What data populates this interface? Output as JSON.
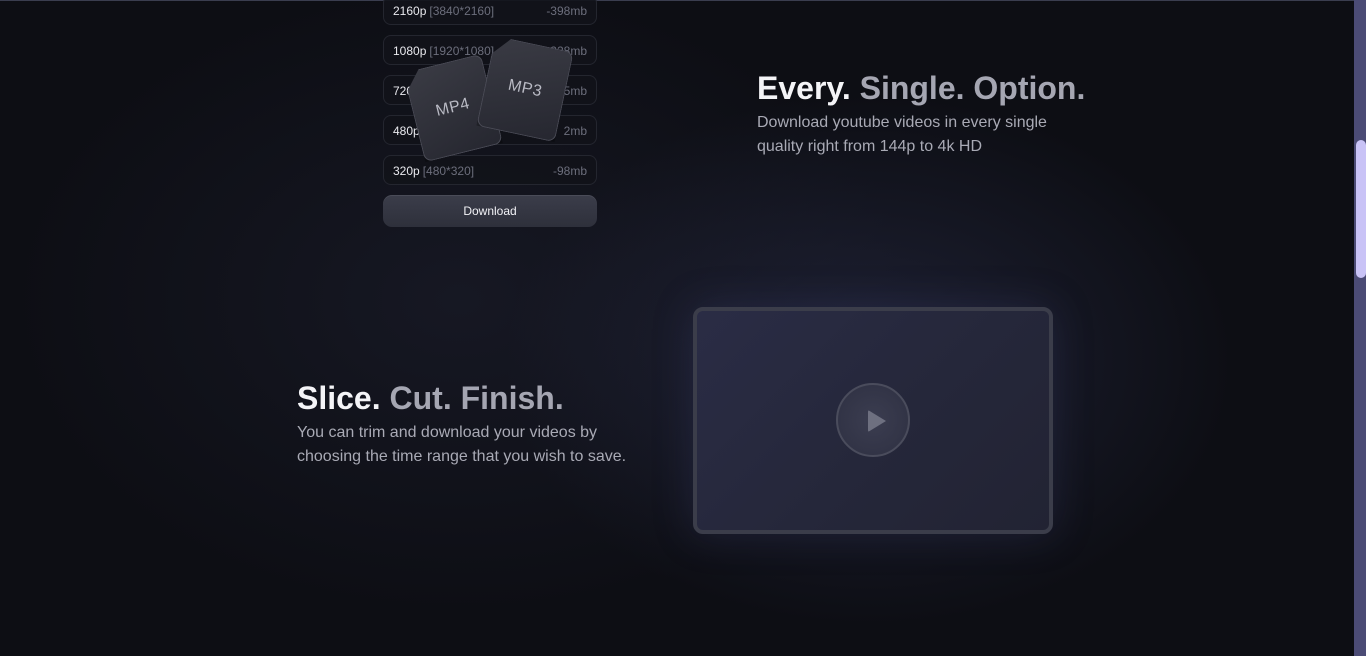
{
  "quality_options": [
    {
      "res": "2160p",
      "dim": "[3840*2160]",
      "size": "-398mb"
    },
    {
      "res": "1080p",
      "dim": "[1920*1080]",
      "size": "-328mb"
    },
    {
      "res": "720",
      "dim": "",
      "size": "5mb"
    },
    {
      "res": "480p",
      "dim": "",
      "size": "2mb"
    },
    {
      "res": "320p",
      "dim": "[480*320]",
      "size": "-98mb"
    }
  ],
  "download_label": "Download",
  "file_cards": {
    "mp4": "MP4",
    "mp3": "MP3"
  },
  "feature_options": {
    "title_w1": "Every.",
    "title_w2": "Single.",
    "title_w3": "Option.",
    "description": "Download youtube videos in every single quality right from 144p to 4k HD"
  },
  "feature_trim": {
    "title_w1": "Slice.",
    "title_w2": "Cut.",
    "title_w3": "Finish.",
    "description": "You can trim and download your videos by choosing the time range that you wish to save."
  },
  "colors": {
    "background": "#0d0e14",
    "scrollbar_track": "#4b4b75",
    "scrollbar_thumb": "#c9c3f6"
  },
  "icons": {
    "play": "play-icon"
  }
}
